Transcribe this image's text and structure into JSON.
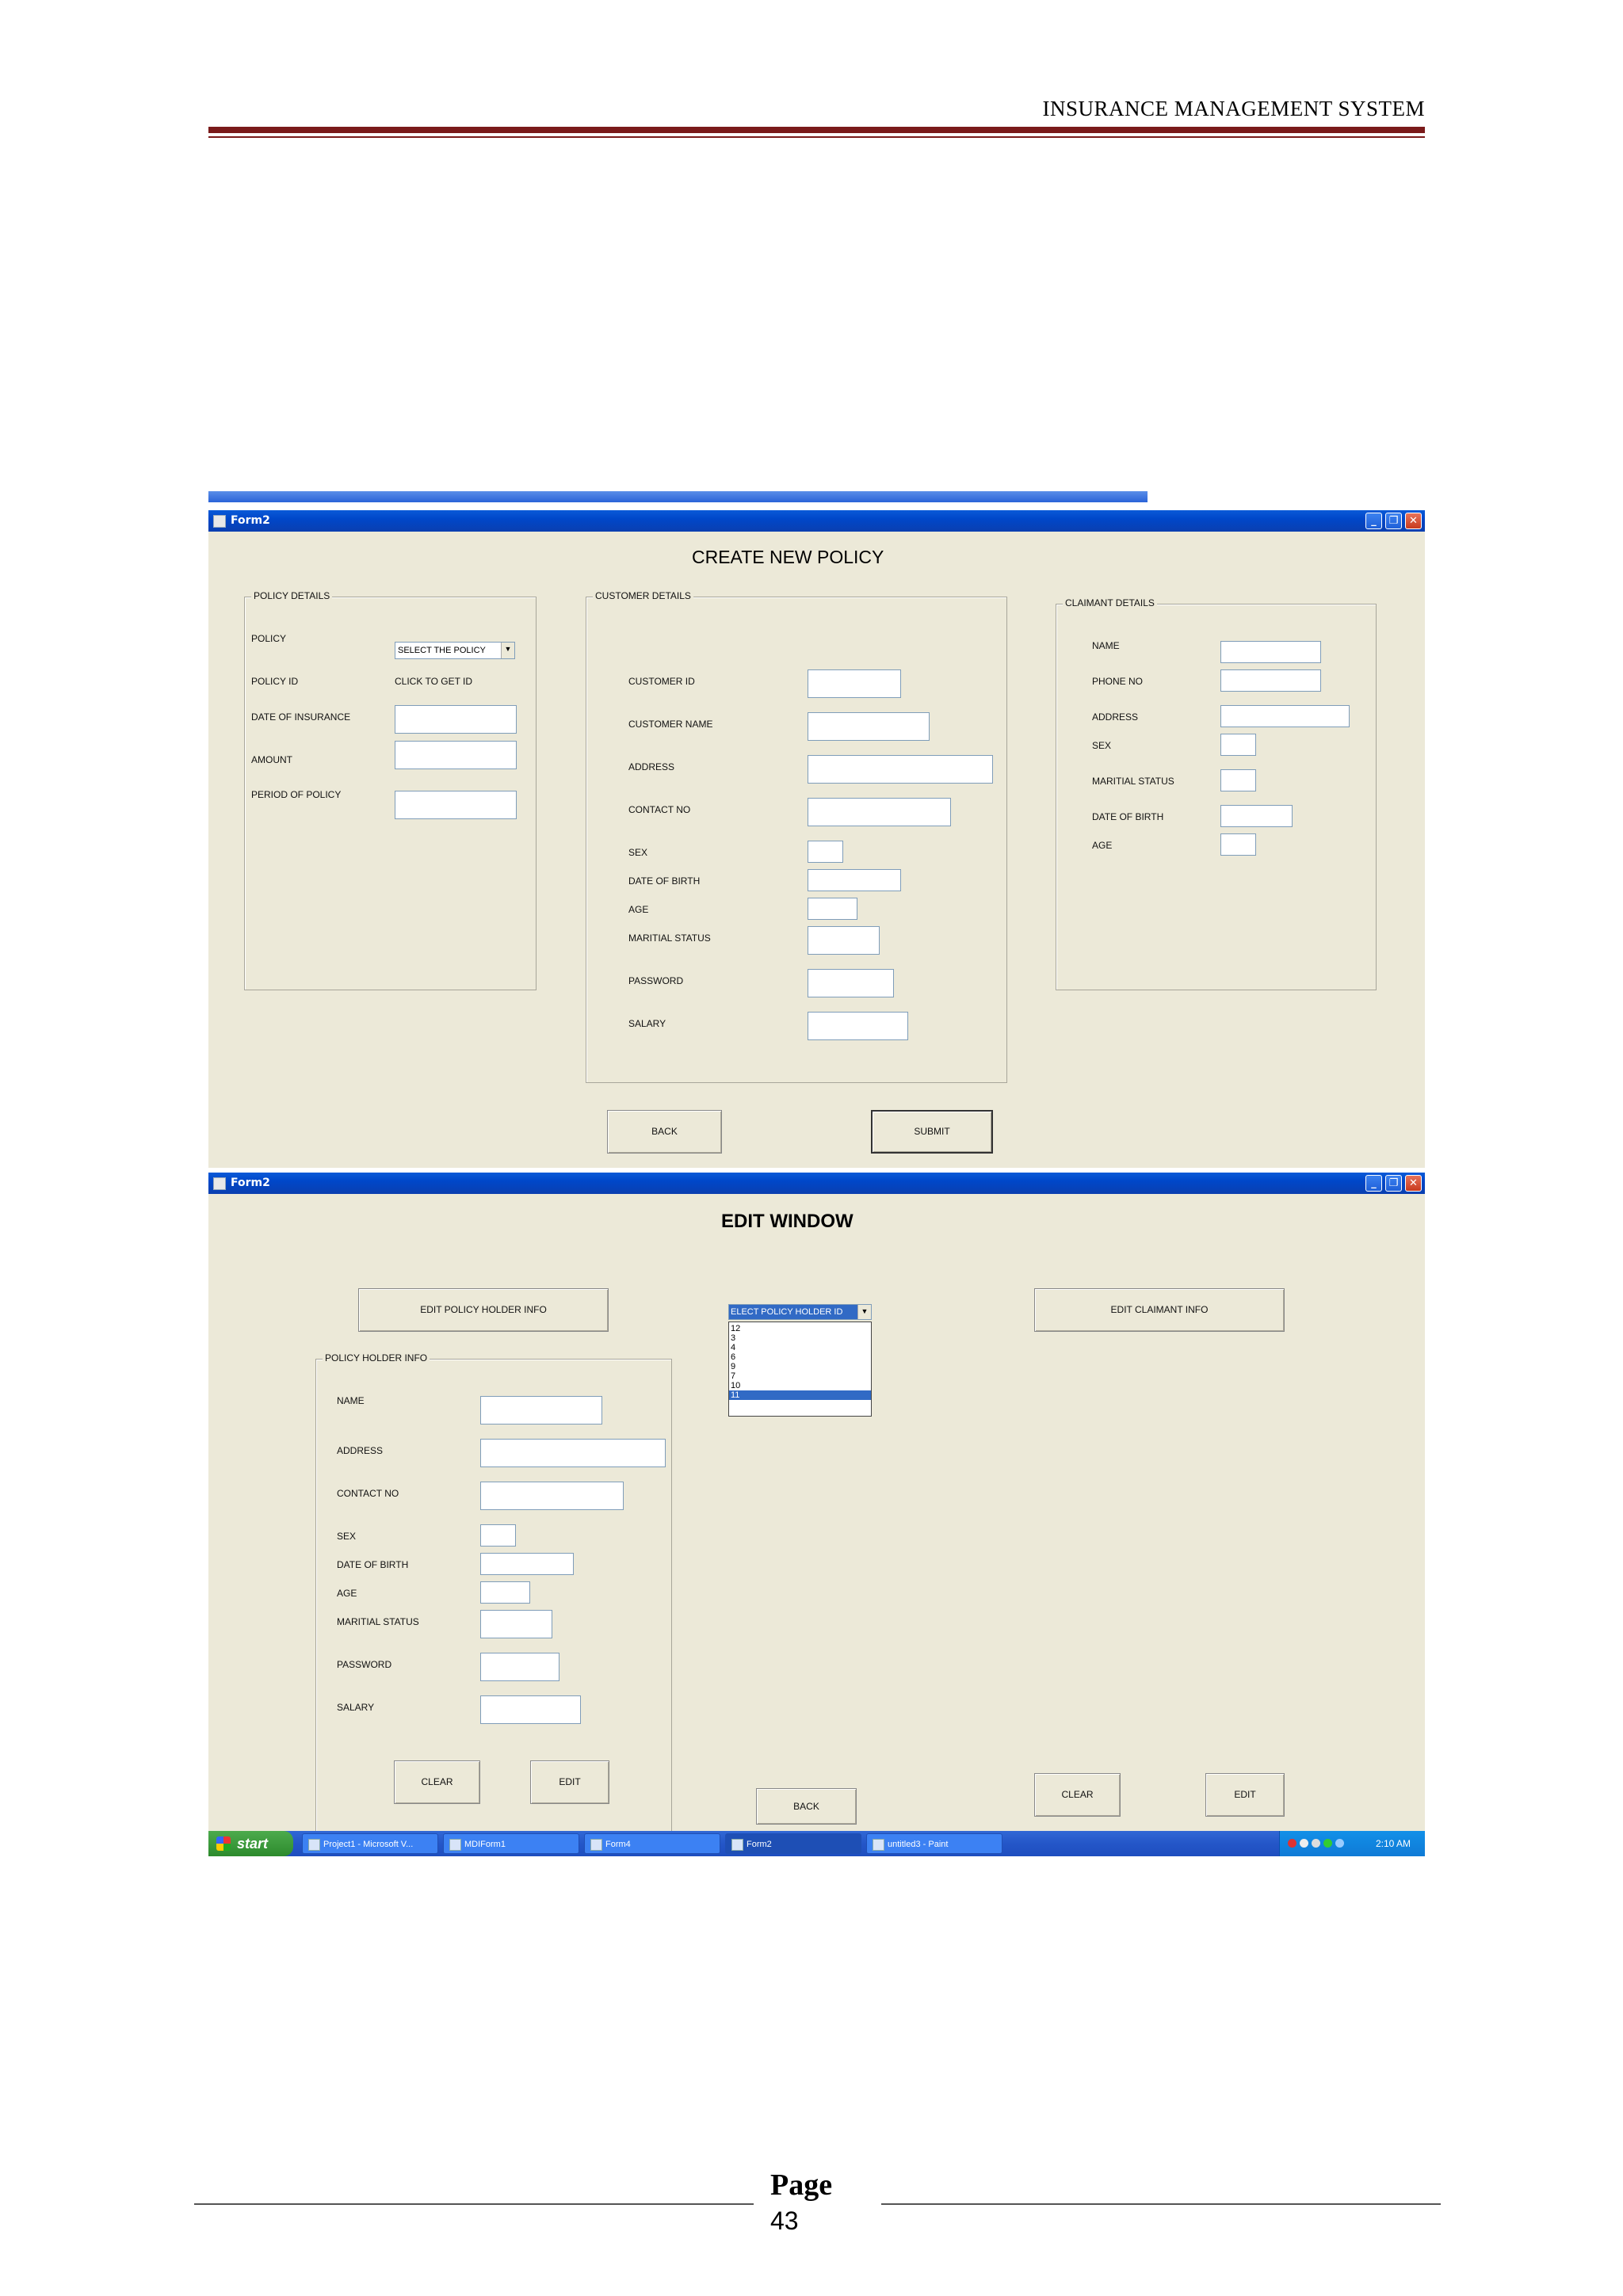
{
  "document": {
    "header_title": "INSURANCE  MANAGEMENT SYSTEM",
    "footer_page_word": "Page",
    "footer_page_number": "43"
  },
  "create_window": {
    "title": "Form2",
    "heading": "CREATE NEW POLICY",
    "policy_details": {
      "caption": "POLICY DETAILS",
      "policy_label": "POLICY",
      "policy_select_value": "SELECT THE POLICY",
      "policy_id_label": "POLICY ID",
      "policy_id_value": "CLICK TO GET ID",
      "date_label": "DATE OF INSURANCE",
      "amount_label": "AMOUNT",
      "period_label": "PERIOD OF POLICY"
    },
    "customer_details": {
      "caption": "CUSTOMER DETAILS",
      "labels": [
        "CUSTOMER ID",
        "CUSTOMER NAME",
        "ADDRESS",
        "CONTACT NO",
        "SEX",
        "DATE OF BIRTH",
        "AGE",
        "MARITIAL STATUS",
        "PASSWORD",
        "SALARY"
      ]
    },
    "claimant_details": {
      "caption": "CLAIMANT DETAILS",
      "labels": [
        "NAME",
        "PHONE NO",
        "ADDRESS",
        "SEX",
        "MARITIAL STATUS",
        "DATE OF BIRTH",
        "AGE"
      ]
    },
    "back_button": "BACK",
    "submit_button": "SUBMIT"
  },
  "edit_window": {
    "title": "Form2",
    "heading": "EDIT WINDOW",
    "edit_policy_holder_button": "EDIT POLICY HOLDER INFO",
    "edit_claimant_button": "EDIT CLAIMANT INFO",
    "dropdown_value": "ELECT POLICY HOLDER ID",
    "dropdown_options": [
      "12",
      "3",
      "4",
      "6",
      "9",
      "7",
      "10",
      "11"
    ],
    "dropdown_selected": "11",
    "policy_holder_info": {
      "caption": "POLICY HOLDER INFO",
      "labels": [
        "NAME",
        "ADDRESS",
        "CONTACT NO",
        "SEX",
        "DATE OF BIRTH",
        "AGE",
        "MARITIAL STATUS",
        "PASSWORD",
        "SALARY"
      ]
    },
    "clear_button_left": "CLEAR",
    "edit_button_left": "EDIT",
    "back_button": "BACK",
    "clear_button_right": "CLEAR",
    "edit_button_right": "EDIT"
  },
  "taskbar": {
    "start_label": "start",
    "tasks": [
      "Project1 - Microsoft V...",
      "MDIForm1",
      "Form4",
      "Form2",
      "untitled3 - Paint"
    ],
    "active_task": "Form2",
    "clock": "2:10 AM"
  }
}
